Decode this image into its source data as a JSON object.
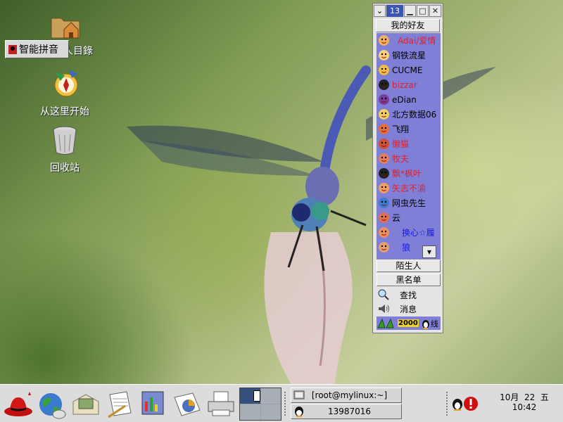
{
  "desktop": {
    "icons": [
      {
        "label": "人目錄",
        "icon": "home-folder-icon"
      },
      {
        "label": "从这里开始",
        "icon": "start-here-icon"
      },
      {
        "label": "回收站",
        "icon": "trash-icon"
      }
    ],
    "ime_label": "智能拼音"
  },
  "qq": {
    "title_number": "13",
    "tab_friends": "我的好友",
    "friends": [
      {
        "name": "Adai/爱情",
        "color": "#e0202a"
      },
      {
        "name": "钢铁流星",
        "color": "#000000"
      },
      {
        "name": "CUCME",
        "color": "#000000"
      },
      {
        "name": "bizzar",
        "color": "#e0202a"
      },
      {
        "name": "eDian",
        "color": "#000000"
      },
      {
        "name": "北方数据06",
        "color": "#000000"
      },
      {
        "name": "飞翔",
        "color": "#000000"
      },
      {
        "name": "懒猫",
        "color": "#e0202a"
      },
      {
        "name": "牧夫",
        "color": "#e0202a"
      },
      {
        "name": "飘*枫叶",
        "color": "#e0202a"
      },
      {
        "name": "矢志不渝",
        "color": "#e0202a"
      },
      {
        "name": "网虫先生",
        "color": "#000000"
      },
      {
        "name": "云",
        "color": "#000000"
      },
      {
        "name": "换心☆履",
        "color": "#1a1adc"
      },
      {
        "name": "狼",
        "color": "#1a1adc"
      }
    ],
    "tab_strangers": "陌生人",
    "tab_blacklist": "黑名单",
    "search_label": "查找",
    "message_label": "消息",
    "status_label": "线",
    "status_badge": "2000"
  },
  "taskbar": {
    "tasks": [
      {
        "label": "[root@mylinux:~]"
      },
      {
        "label": "13987016"
      }
    ],
    "clock_date": "10月  22  五",
    "clock_time": "10:42"
  },
  "colors": {
    "qq_list_bg": "#7f7fd8",
    "accent_blue": "#3b55b0",
    "taskbar_bg": "#dcdcdc"
  }
}
